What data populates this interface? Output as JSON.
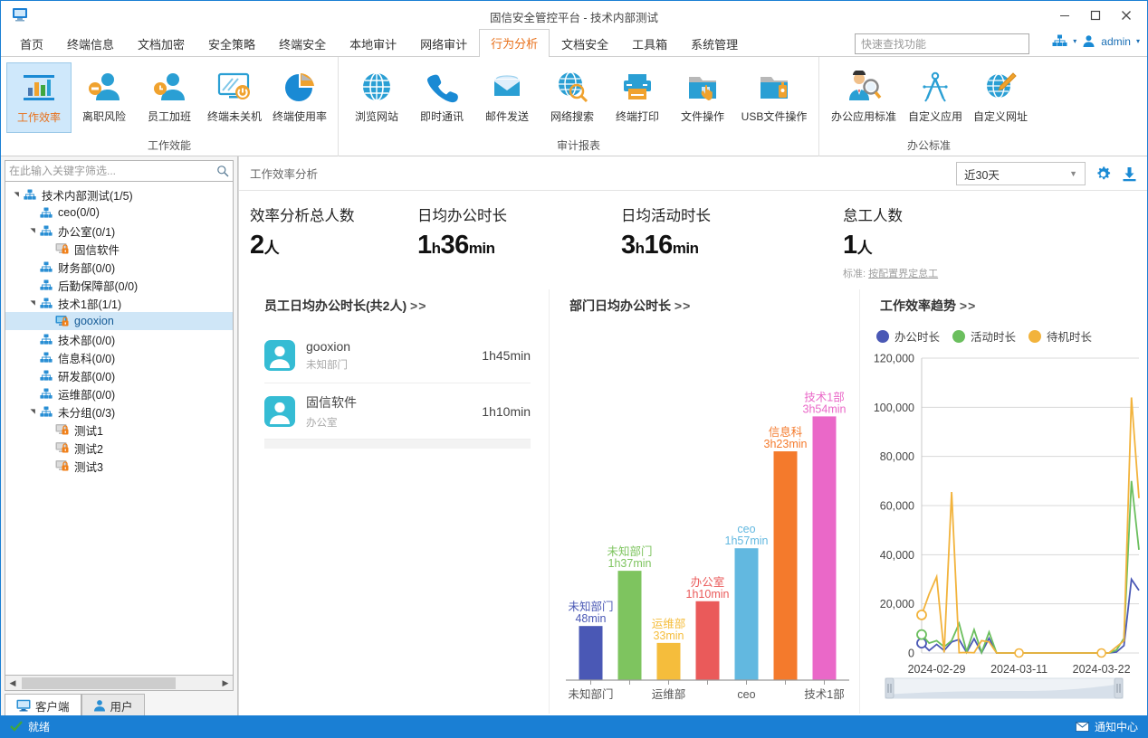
{
  "window": {
    "title": "固信安全管控平台 - 技术内部测试",
    "logo_icon": "monitor-icon",
    "minimize": "–",
    "maximize": "□",
    "close": "✕"
  },
  "menubar": {
    "tabs": [
      {
        "label": "首页",
        "active": false
      },
      {
        "label": "终端信息",
        "active": false
      },
      {
        "label": "文档加密",
        "active": false
      },
      {
        "label": "安全策略",
        "active": false
      },
      {
        "label": "终端安全",
        "active": false
      },
      {
        "label": "本地审计",
        "active": false
      },
      {
        "label": "网络审计",
        "active": false
      },
      {
        "label": "行为分析",
        "active": true
      },
      {
        "label": "文档安全",
        "active": false
      },
      {
        "label": "工具箱",
        "active": false
      },
      {
        "label": "系统管理",
        "active": false
      }
    ],
    "search_placeholder": "快速查找功能",
    "org_icon": "org-tree-icon",
    "user_icon": "user-icon",
    "user_name": "admin"
  },
  "ribbon": {
    "groups": [
      {
        "title": "工作效能",
        "items": [
          {
            "label": "工作效率",
            "icon": "bar-chart-icon",
            "selected": true
          },
          {
            "label": "离职风险",
            "icon": "user-minus-icon",
            "selected": false
          },
          {
            "label": "员工加班",
            "icon": "user-clock-icon",
            "selected": false
          },
          {
            "label": "终端未关机",
            "icon": "monitor-power-icon",
            "selected": false
          },
          {
            "label": "终端使用率",
            "icon": "pie-chart-icon",
            "selected": false
          }
        ]
      },
      {
        "title": "审计报表",
        "items": [
          {
            "label": "浏览网站",
            "icon": "globe-icon",
            "selected": false
          },
          {
            "label": "即时通讯",
            "icon": "phone-icon",
            "selected": false
          },
          {
            "label": "邮件发送",
            "icon": "mail-icon",
            "selected": false
          },
          {
            "label": "网络搜索",
            "icon": "globe-search-icon",
            "selected": false
          },
          {
            "label": "终端打印",
            "icon": "printer-icon",
            "selected": false
          },
          {
            "label": "文件操作",
            "icon": "folder-hand-icon",
            "selected": false
          },
          {
            "label": "USB文件操作",
            "icon": "folder-usb-icon",
            "selected": false
          }
        ]
      },
      {
        "title": "办公标准",
        "items": [
          {
            "label": "办公应用标准",
            "icon": "person-search-icon",
            "selected": false
          },
          {
            "label": "自定义应用",
            "icon": "compass-icon",
            "selected": false
          },
          {
            "label": "自定义网址",
            "icon": "globe-pencil-icon",
            "selected": false
          }
        ]
      }
    ]
  },
  "sidebar": {
    "filter_placeholder": "在此输入关键字筛选...",
    "search_icon": "search-icon",
    "tree": [
      {
        "label": "技术内部测试(1/5)",
        "depth": 0,
        "arrow": "expanded",
        "icon": "org-icon",
        "selected": false
      },
      {
        "label": "ceo(0/0)",
        "depth": 1,
        "arrow": "none",
        "icon": "org-icon",
        "selected": false
      },
      {
        "label": "办公室(0/1)",
        "depth": 1,
        "arrow": "expanded",
        "icon": "org-icon",
        "selected": false
      },
      {
        "label": "固信软件",
        "depth": 2,
        "arrow": "none",
        "icon": "computer-lock-icon",
        "selected": false
      },
      {
        "label": "财务部(0/0)",
        "depth": 1,
        "arrow": "none",
        "icon": "org-icon",
        "selected": false
      },
      {
        "label": "后勤保障部(0/0)",
        "depth": 1,
        "arrow": "none",
        "icon": "org-icon",
        "selected": false
      },
      {
        "label": "技术1部(1/1)",
        "depth": 1,
        "arrow": "expanded",
        "icon": "org-icon",
        "selected": false
      },
      {
        "label": "gooxion",
        "depth": 2,
        "arrow": "none",
        "icon": "computer-online-icon",
        "selected": true
      },
      {
        "label": "技术部(0/0)",
        "depth": 1,
        "arrow": "none",
        "icon": "org-icon",
        "selected": false
      },
      {
        "label": "信息科(0/0)",
        "depth": 1,
        "arrow": "none",
        "icon": "org-icon",
        "selected": false
      },
      {
        "label": "研发部(0/0)",
        "depth": 1,
        "arrow": "none",
        "icon": "org-icon",
        "selected": false
      },
      {
        "label": "运维部(0/0)",
        "depth": 1,
        "arrow": "none",
        "icon": "org-icon",
        "selected": false
      },
      {
        "label": "未分组(0/3)",
        "depth": 1,
        "arrow": "expanded",
        "icon": "org-icon",
        "selected": false
      },
      {
        "label": "测试1",
        "depth": 2,
        "arrow": "none",
        "icon": "computer-lock-icon",
        "selected": false
      },
      {
        "label": "测试2",
        "depth": 2,
        "arrow": "none",
        "icon": "computer-lock-icon",
        "selected": false
      },
      {
        "label": "测试3",
        "depth": 2,
        "arrow": "none",
        "icon": "computer-lock-icon",
        "selected": false
      }
    ],
    "bottom_tabs": [
      {
        "label": "客户端",
        "icon": "monitor-icon",
        "active": true
      },
      {
        "label": "用户",
        "icon": "user-icon",
        "active": false
      }
    ]
  },
  "content": {
    "caption": "工作效率分析",
    "range_value": "近30天",
    "settings_icon": "gear-icon",
    "export_icon": "download-icon",
    "kpis": [
      {
        "title": "效率分析总人数",
        "value": "2",
        "unit": "人",
        "note": ""
      },
      {
        "title": "日均办公时长",
        "value": "1",
        "unit": "h",
        "value2": "36",
        "unit2": "min",
        "note": ""
      },
      {
        "title": "日均活动时长",
        "value": "3",
        "unit": "h",
        "value2": "16",
        "unit2": "min",
        "note": ""
      },
      {
        "title": "怠工人数",
        "value": "1",
        "unit": "人",
        "note_prefix": "标准: ",
        "note_link": "按配置界定怠工"
      }
    ],
    "employee_panel": {
      "title": "员工日均办公时长(共2人)",
      "more": ">>",
      "rows": [
        {
          "name": "gooxion",
          "dept": "未知部门",
          "value": "1h45min",
          "avatar_icon": "avatar-icon"
        },
        {
          "name": "固信软件",
          "dept": "办公室",
          "value": "1h10min",
          "avatar_icon": "avatar-icon"
        }
      ]
    },
    "bar_panel": {
      "title": "部门日均办公时长",
      "more": ">>"
    },
    "line_panel": {
      "title": "工作效率趋势",
      "more": ">>"
    }
  },
  "chart_data": [
    {
      "type": "bar",
      "title": "部门日均办公时长",
      "xlabel": "",
      "ylabel": "",
      "categories": [
        "未知部门",
        "未知部门",
        "运维部",
        "办公室",
        "ceo",
        "信息科",
        "技术1部"
      ],
      "axis_tick_labels": [
        "未知部门",
        "",
        "运维部",
        "",
        "ceo",
        "",
        "技术1部"
      ],
      "value_labels": [
        "48min",
        "1h37min",
        "33min",
        "1h10min",
        "1h57min",
        "3h23min",
        "3h54min"
      ],
      "values": [
        48,
        97,
        33,
        70,
        117,
        203,
        234
      ],
      "unit": "minutes",
      "ylim": [
        0,
        260
      ],
      "grid": false,
      "colors": [
        "#4a58b5",
        "#7ec45f",
        "#f5bd3c",
        "#ea5a5a",
        "#62b8e0",
        "#f47a2c",
        "#ea68c8"
      ]
    },
    {
      "type": "line",
      "title": "工作效率趋势",
      "legend": [
        {
          "name": "办公时长",
          "color": "#4a58b5"
        },
        {
          "name": "活动时长",
          "color": "#6bbf5e"
        },
        {
          "name": "待机时长",
          "color": "#f2b33c"
        }
      ],
      "legend_position": "top",
      "grid": true,
      "ylim": [
        0,
        120000
      ],
      "yticks": [
        0,
        20000,
        40000,
        60000,
        80000,
        100000,
        120000
      ],
      "ytick_labels": [
        "0",
        "20,000",
        "40,000",
        "60,000",
        "80,000",
        "100,000",
        "120,000"
      ],
      "xtick_labels": [
        "2024-02-29",
        "2024-03-11",
        "2024-03-22"
      ],
      "x": [
        "2024-02-27",
        "2024-02-28",
        "2024-02-29",
        "2024-03-01",
        "2024-03-02",
        "2024-03-03",
        "2024-03-04",
        "2024-03-05",
        "2024-03-06",
        "2024-03-07",
        "2024-03-08",
        "2024-03-09",
        "2024-03-10",
        "2024-03-11",
        "2024-03-12",
        "2024-03-13",
        "2024-03-14",
        "2024-03-15",
        "2024-03-16",
        "2024-03-17",
        "2024-03-18",
        "2024-03-19",
        "2024-03-20",
        "2024-03-21",
        "2024-03-22",
        "2024-03-23",
        "2024-03-24",
        "2024-03-25",
        "2024-03-26",
        "2024-03-27"
      ],
      "series": [
        {
          "name": "办公时长",
          "color": "#4a58b5",
          "values": [
            4000,
            1000,
            3500,
            1000,
            4500,
            5500,
            200,
            5800,
            100,
            6000,
            0,
            0,
            0,
            0,
            0,
            0,
            0,
            0,
            0,
            0,
            0,
            0,
            0,
            0,
            0,
            0,
            400,
            3000,
            30000,
            25500
          ]
        },
        {
          "name": "活动时长",
          "color": "#6bbf5e",
          "values": [
            7500,
            4000,
            5000,
            2500,
            5000,
            12000,
            600,
            9500,
            200,
            8500,
            0,
            0,
            0,
            0,
            0,
            0,
            0,
            0,
            0,
            0,
            0,
            0,
            0,
            0,
            0,
            0,
            1200,
            6000,
            70000,
            42000
          ]
        },
        {
          "name": "待机时长",
          "color": "#f2b33c",
          "values": [
            15500,
            24000,
            31000,
            200,
            65500,
            100,
            200,
            100,
            5000,
            4500,
            0,
            0,
            0,
            0,
            0,
            0,
            0,
            0,
            0,
            0,
            0,
            0,
            0,
            0,
            0,
            0,
            2500,
            5000,
            104000,
            63000
          ]
        }
      ],
      "scrollbar": true
    }
  ],
  "statusbar": {
    "ready_icon": "check-icon",
    "ready_text": "就绪",
    "notice_icon": "mail-icon",
    "notice_text": "通知中心"
  }
}
